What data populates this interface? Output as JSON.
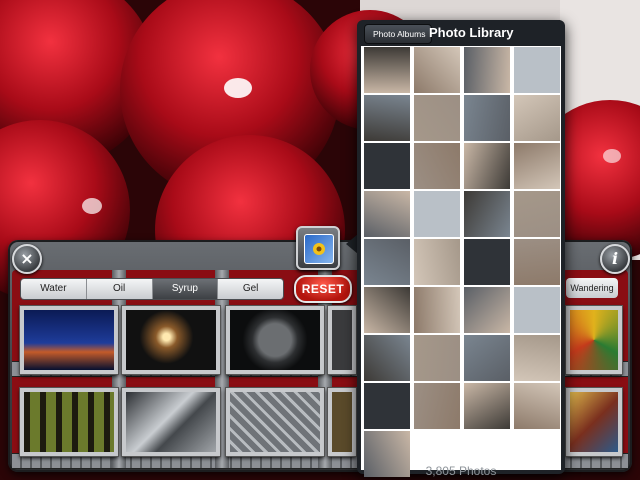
{
  "segments": [
    "Water",
    "Oil",
    "Syrup",
    "Gel"
  ],
  "active_segment": "Syrup",
  "reset_label": "RESET",
  "wander_label": "Wandering",
  "close_label": "×",
  "info_label": "i",
  "popover": {
    "back_label": "Photo Albums",
    "title": "Photo Library",
    "count_label": "3,805 Photos"
  },
  "filter_thumbs": [
    {
      "name": "night-city"
    },
    {
      "name": "fireworks"
    },
    {
      "name": "earth-sphere"
    },
    {
      "name": "forest"
    },
    {
      "name": "metal-pipes"
    },
    {
      "name": "diamond-plate"
    }
  ],
  "photos": [
    "child",
    "child-food",
    "street-crowd",
    "storefront",
    "office-people",
    "corridor",
    "lobby",
    "person-phone",
    "presenter",
    "speaker",
    "woman-camera",
    "dark-room",
    "crowd-queue",
    "woman-shirt",
    "people-inside",
    "store-sign",
    "hall",
    "audience",
    "woman-camera-2",
    "man-dark",
    "woman-smile",
    "man-shirt",
    "crowd-room",
    "woman-phone",
    "man-stand",
    "speaker-mic",
    "man-camera",
    "man-suit",
    "man-portrait",
    "woman-phone-2",
    "man-group",
    "white-dog",
    "computer-desk"
  ]
}
